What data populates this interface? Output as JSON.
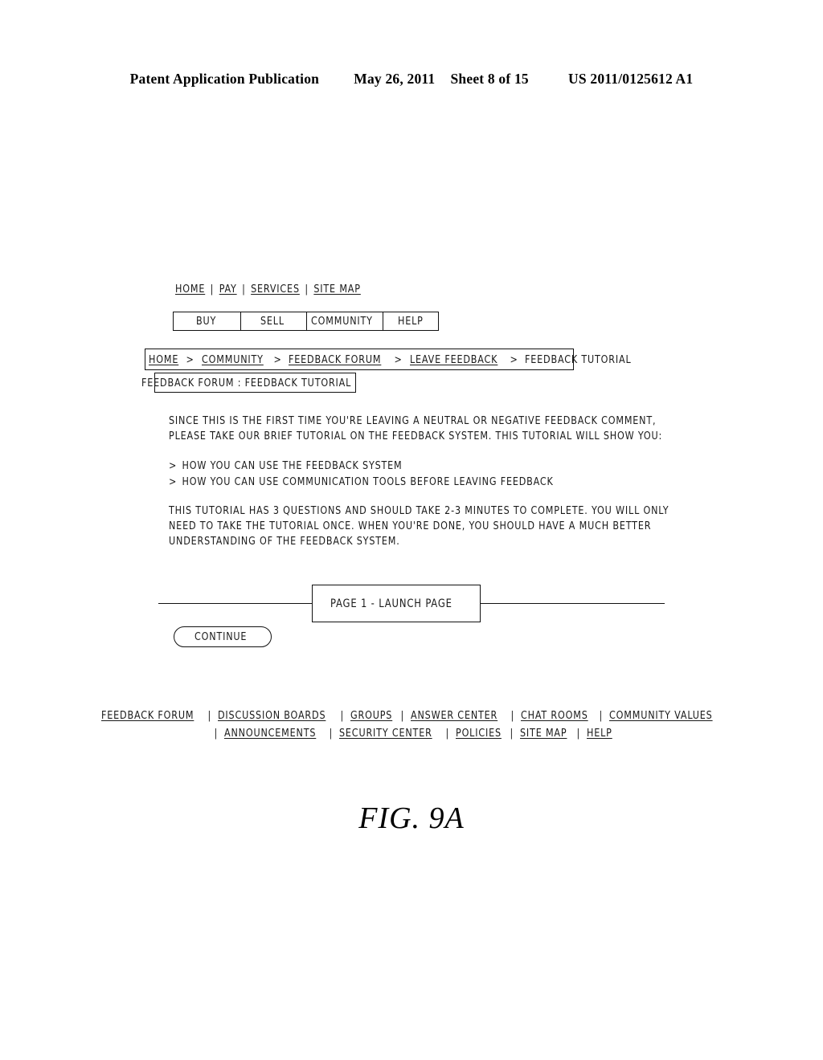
{
  "patent_header": {
    "publication": "Patent Application Publication",
    "date": "May 26, 2011",
    "sheet": "Sheet 8 of 15",
    "number": "US 2011/0125612 A1"
  },
  "figure": {
    "caption": "FIG. 9A"
  },
  "screen": {
    "top_nav": {
      "separator": "|",
      "items": [
        {
          "label": "HOME"
        },
        {
          "label": "PAY"
        },
        {
          "label": "SERVICES"
        },
        {
          "label": "SITE MAP"
        }
      ]
    },
    "tab_bar": {
      "tabs": [
        {
          "label": "BUY"
        },
        {
          "label": "SELL"
        },
        {
          "label": "COMMUNITY"
        },
        {
          "label": "HELP"
        }
      ]
    },
    "breadcrumb": {
      "arrow": ">",
      "items": [
        {
          "label": "HOME",
          "is_link": true
        },
        {
          "label": "COMMUNITY",
          "is_link": true
        },
        {
          "label": "FEEDBACK FORUM",
          "is_link": true
        },
        {
          "label": "LEAVE FEEDBACK",
          "is_link": true
        },
        {
          "label": "FEEDBACK TUTORIAL",
          "is_link": false
        }
      ]
    },
    "page_title": "FEEDBACK FORUM : FEEDBACK TUTORIAL",
    "body": {
      "intro_line_1": "SINCE THIS IS THE FIRST TIME YOU'RE LEAVING A NEUTRAL OR NEGATIVE FEEDBACK COMMENT,",
      "intro_line_2": "PLEASE TAKE OUR BRIEF TUTORIAL ON THE FEEDBACK SYSTEM. THIS TUTORIAL WILL SHOW YOU:",
      "bullet_marker": ">",
      "bullets": [
        {
          "label": "HOW YOU CAN USE THE FEEDBACK SYSTEM"
        },
        {
          "label": "HOW YOU CAN USE COMMUNICATION TOOLS BEFORE LEAVING FEEDBACK"
        }
      ],
      "closing_line_1": "THIS TUTORIAL HAS 3 QUESTIONS AND SHOULD TAKE 2-3 MINUTES TO COMPLETE. YOU WILL ONLY",
      "closing_line_2": "NEED TO TAKE THE TUTORIAL ONCE. WHEN YOU'RE DONE, YOU SHOULD HAVE A MUCH BETTER",
      "closing_line_3": "UNDERSTANDING OF THE FEEDBACK SYSTEM."
    },
    "page_marker": "PAGE 1 - LAUNCH PAGE",
    "continue_button": "CONTINUE",
    "footer": {
      "separator": "|",
      "row_1": [
        {
          "label": "FEEDBACK FORUM"
        },
        {
          "label": "DISCUSSION BOARDS"
        },
        {
          "label": "GROUPS"
        },
        {
          "label": "ANSWER CENTER"
        },
        {
          "label": "CHAT ROOMS"
        },
        {
          "label": "COMMUNITY VALUES"
        }
      ],
      "row_2": [
        {
          "label": "ANNOUNCEMENTS"
        },
        {
          "label": "SECURITY CENTER"
        },
        {
          "label": "POLICIES"
        },
        {
          "label": "SITE MAP"
        },
        {
          "label": "HELP"
        }
      ]
    }
  }
}
